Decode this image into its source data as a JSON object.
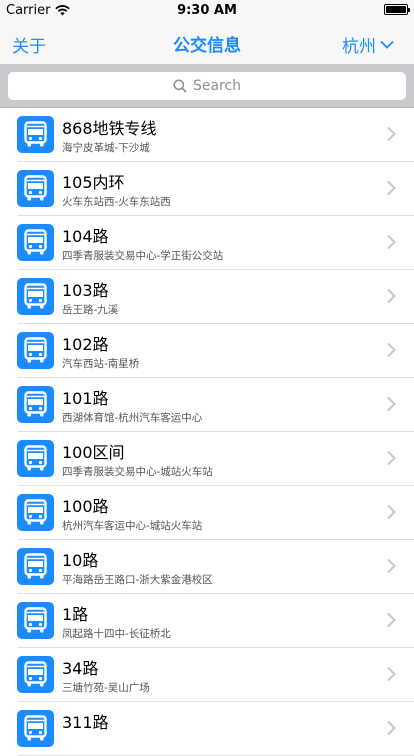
{
  "status": {
    "carrier": "Carrier",
    "time": "9:30 AM"
  },
  "nav": {
    "left": "关于",
    "title": "公交信息",
    "city": "杭州"
  },
  "search": {
    "placeholder": "Search"
  },
  "routes": [
    {
      "name": "868地铁专线",
      "path": "海宁皮革城-下沙城"
    },
    {
      "name": "105内环",
      "path": "火车东站西-火车东站西"
    },
    {
      "name": "104路",
      "path": "四季青服装交易中心-学正街公交站"
    },
    {
      "name": "103路",
      "path": "岳王路-九溪"
    },
    {
      "name": "102路",
      "path": "汽车西站-南星桥"
    },
    {
      "name": "101路",
      "path": "西湖体育馆-杭州汽车客运中心"
    },
    {
      "name": "100区间",
      "path": "四季青服装交易中心-城站火车站"
    },
    {
      "name": "100路",
      "path": "杭州汽车客运中心-城站火车站"
    },
    {
      "name": "10路",
      "path": "平海路岳王路口-浙大紫金港校区"
    },
    {
      "name": "1路",
      "path": "凤起路十四中-长征桥北"
    },
    {
      "name": "34路",
      "path": "三塘竹苑-吴山广场"
    },
    {
      "name": "311路",
      "path": ""
    }
  ],
  "colors": {
    "accent": "#1a8cff",
    "search_bg": "#c9c9ce"
  },
  "icons": {
    "row_icon": "bus-icon",
    "row_accessory": "chevron-right-icon"
  }
}
